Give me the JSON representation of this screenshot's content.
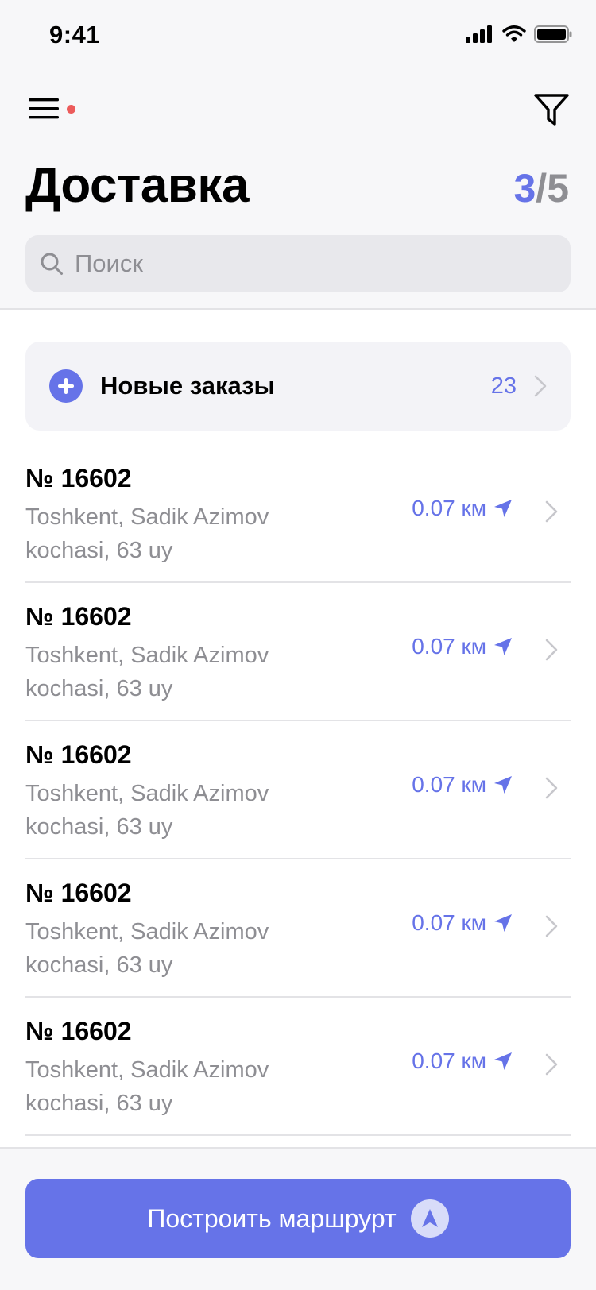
{
  "status_bar": {
    "time": "9:41"
  },
  "header": {
    "title": "Доставка",
    "counter_current": "3",
    "counter_separator": "/",
    "counter_total": "5",
    "menu_icon": "hamburger-icon",
    "filter_icon": "filter-icon",
    "notification_color": "#ec5b5b"
  },
  "search": {
    "placeholder": "Поиск",
    "icon": "search-icon"
  },
  "new_orders": {
    "label": "Новые заказы",
    "count": "23",
    "icon": "plus-circle-icon"
  },
  "orders": [
    {
      "number": "№ 16602",
      "address": "Toshkent, Sadik Azimov kochasi, 63 uy",
      "distance": "0.07 км"
    },
    {
      "number": "№ 16602",
      "address": "Toshkent, Sadik Azimov kochasi, 63 uy",
      "distance": "0.07 км"
    },
    {
      "number": "№ 16602",
      "address": "Toshkent, Sadik Azimov kochasi, 63 uy",
      "distance": "0.07 км"
    },
    {
      "number": "№ 16602",
      "address": "Toshkent, Sadik Azimov kochasi, 63 uy",
      "distance": "0.07 км"
    },
    {
      "number": "№ 16602",
      "address": "Toshkent, Sadik Azimov kochasi, 63 uy",
      "distance": "0.07 км"
    }
  ],
  "route_button": {
    "label": "Построить маршрурт",
    "icon": "navigation-arrow-icon"
  },
  "colors": {
    "accent": "#6673e8",
    "secondary_text": "#8e8e93",
    "background": "#f7f7f9"
  }
}
